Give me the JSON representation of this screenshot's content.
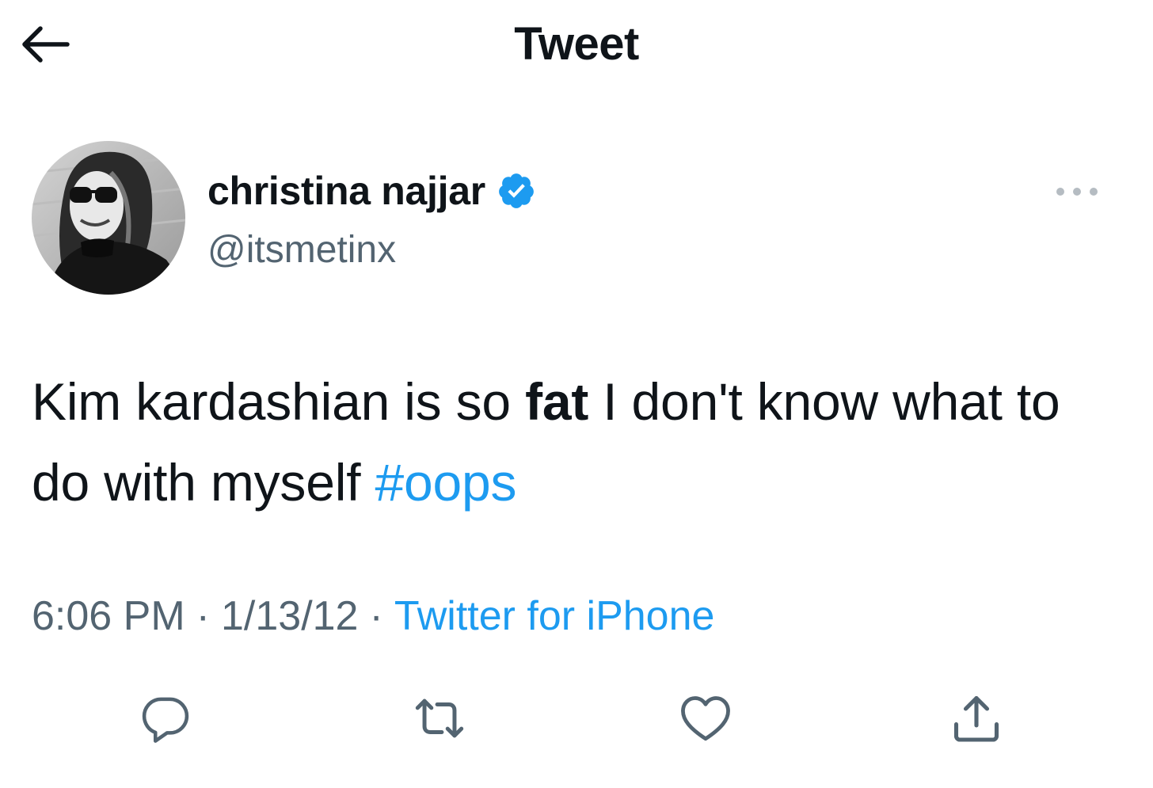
{
  "header": {
    "title": "Tweet",
    "back_icon": "arrow-left-icon"
  },
  "author": {
    "display_name": "christina najjar",
    "handle": "@itsmetinx",
    "verified": true,
    "verified_color": "#1d9bf0"
  },
  "tweet": {
    "text_part1": "Kim kardashian is so ",
    "text_bold": "fat",
    "text_part2": " I don't know what to do with myself ",
    "hashtag": "#oops",
    "time": "6:06 PM",
    "separator": "·",
    "date": "1/13/12",
    "source": "Twitter for iPhone"
  },
  "actions": [
    {
      "name": "reply",
      "icon": "reply-icon"
    },
    {
      "name": "retweet",
      "icon": "retweet-icon"
    },
    {
      "name": "like",
      "icon": "heart-icon"
    },
    {
      "name": "share",
      "icon": "share-icon"
    }
  ],
  "colors": {
    "text": "#0f1419",
    "secondary": "#536471",
    "accent": "#1d9bf0"
  }
}
